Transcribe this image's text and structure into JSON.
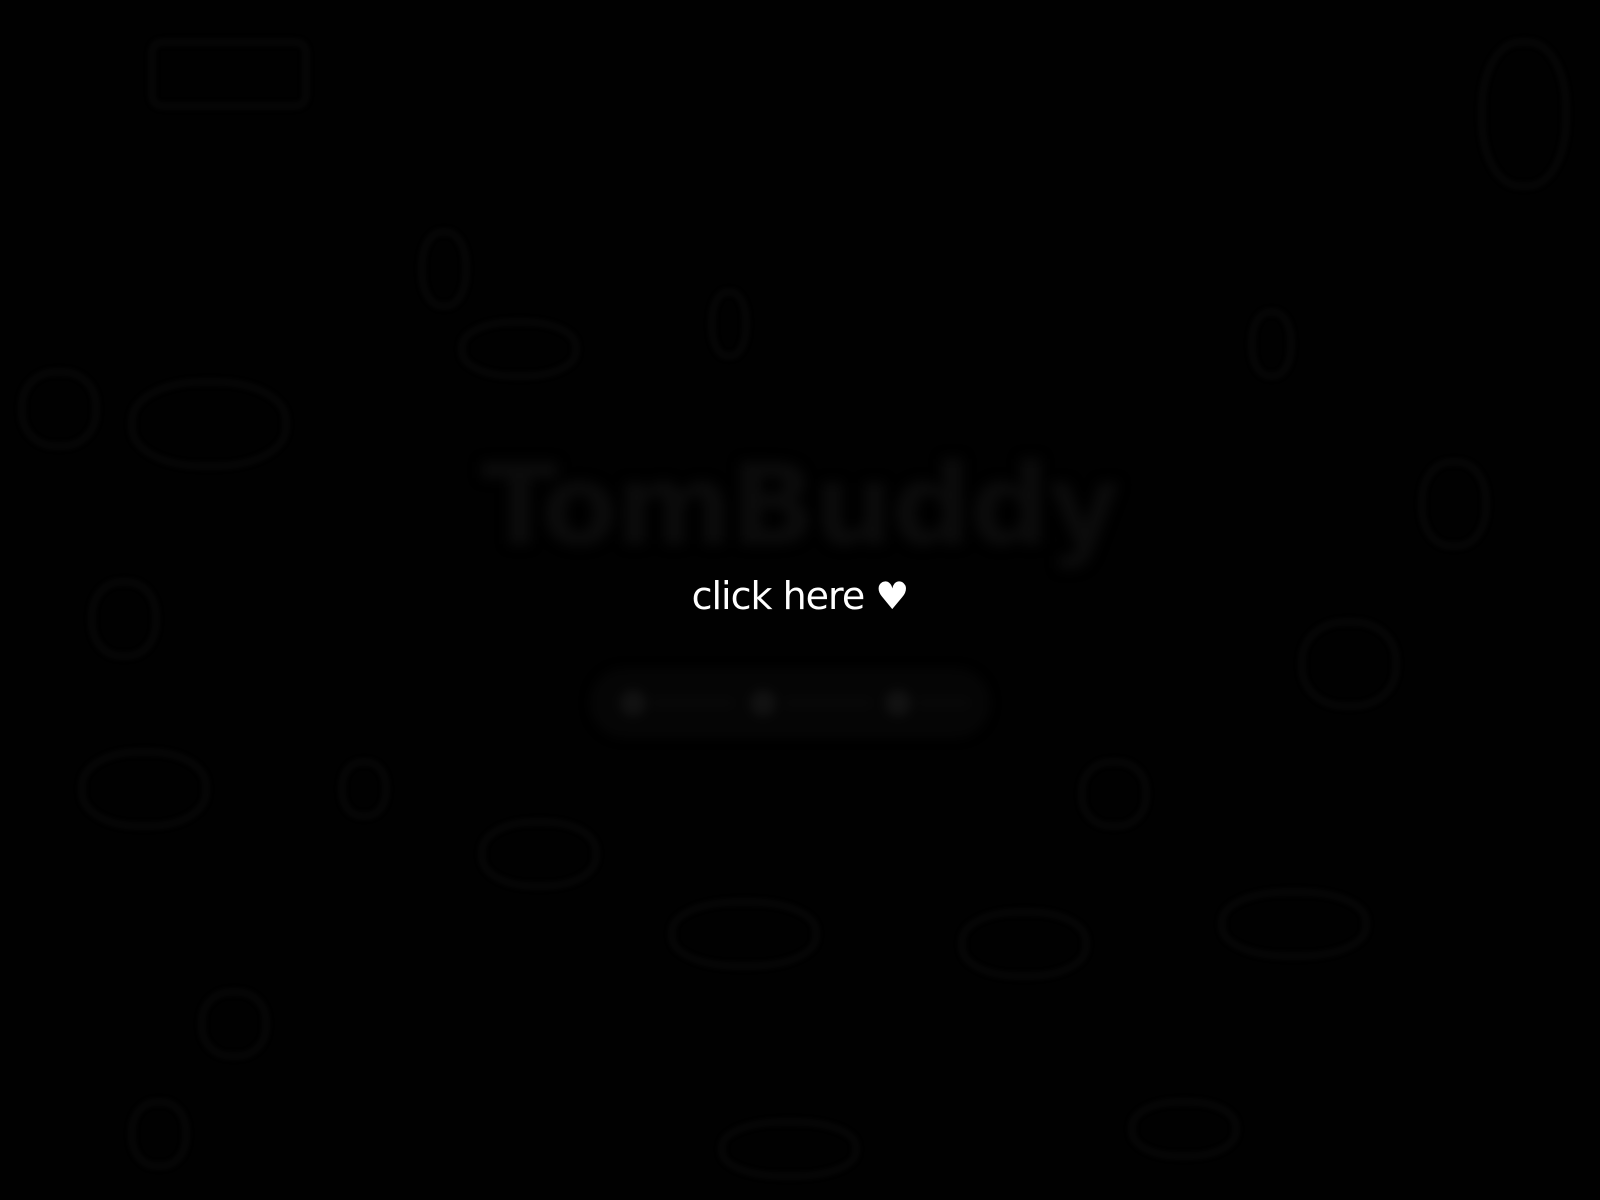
{
  "splash": {
    "brand_name": "TomBuddy",
    "enter_label": "click here ♥"
  },
  "colors": {
    "background": "#010101",
    "enter_text": "#ffffff"
  }
}
